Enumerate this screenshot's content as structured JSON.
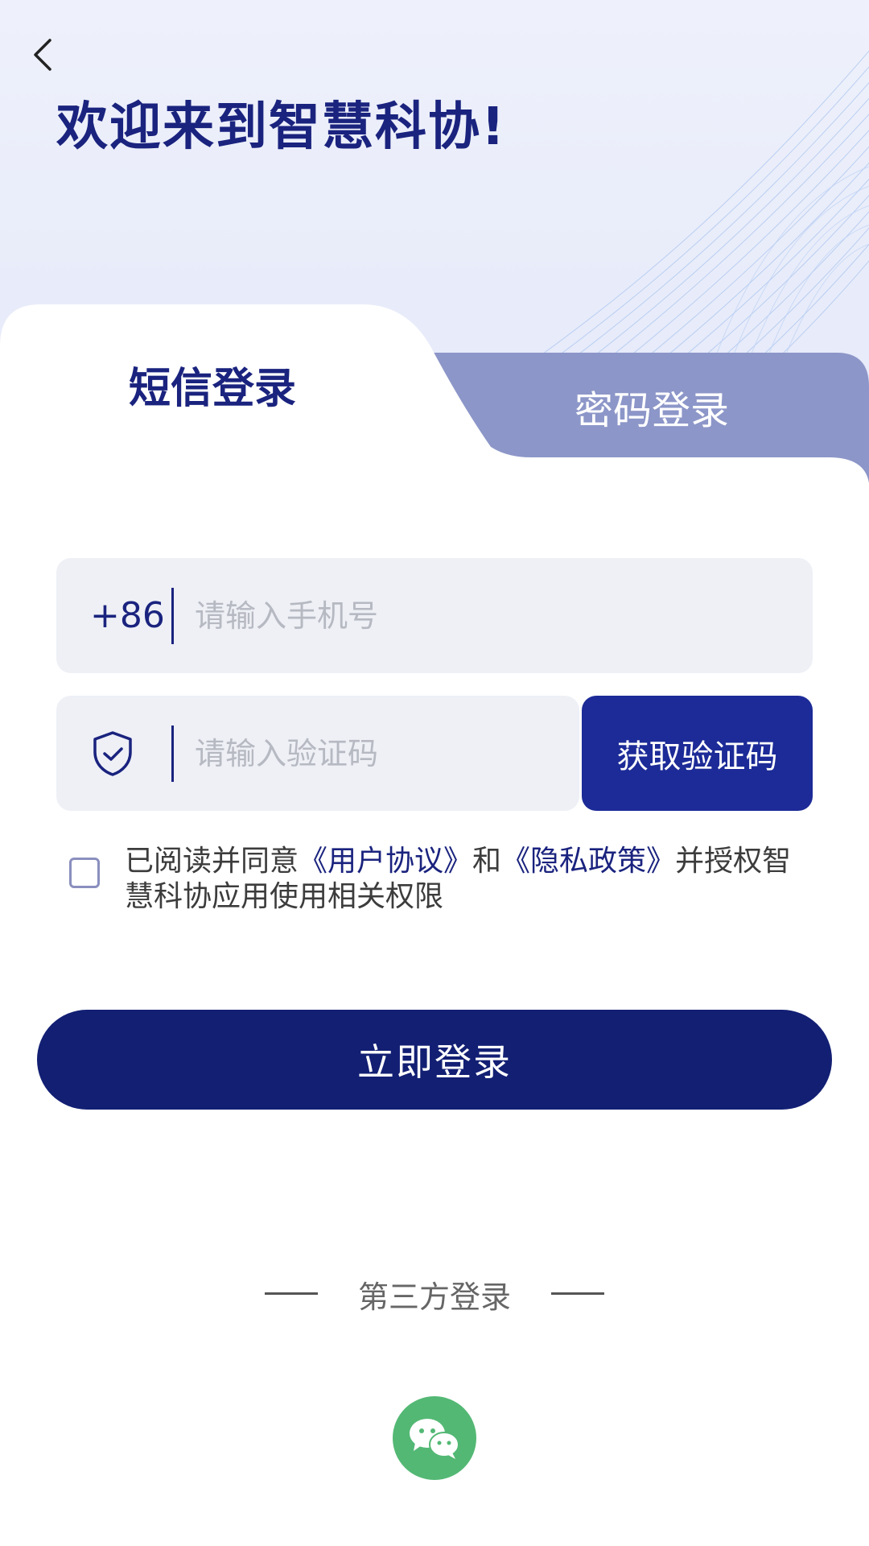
{
  "header": {
    "title": "欢迎来到智慧科协!"
  },
  "tabs": {
    "sms_label": "短信登录",
    "password_label": "密码登录",
    "active": "sms"
  },
  "form": {
    "phone_prefix": "+86",
    "phone_placeholder": "请输入手机号",
    "phone_value": "",
    "code_placeholder": "请输入验证码",
    "code_value": "",
    "get_code_label": "获取验证码"
  },
  "agreement": {
    "checked": false,
    "text_before": "已阅读并同意",
    "user_agreement": "《用户协议》",
    "and": "和",
    "privacy_policy": "《隐私政策》",
    "text_after": "并授权智慧科协应用使用相关权限"
  },
  "login_button": "立即登录",
  "third_party": {
    "label": "第三方登录",
    "providers": [
      "wechat-icon"
    ]
  },
  "colors": {
    "primary_dark": "#121f73",
    "primary": "#1c2b97",
    "title": "#1a237e",
    "tab_inactive": "#8c96c8",
    "wechat": "#53b874",
    "input_bg": "#eef0f6"
  }
}
